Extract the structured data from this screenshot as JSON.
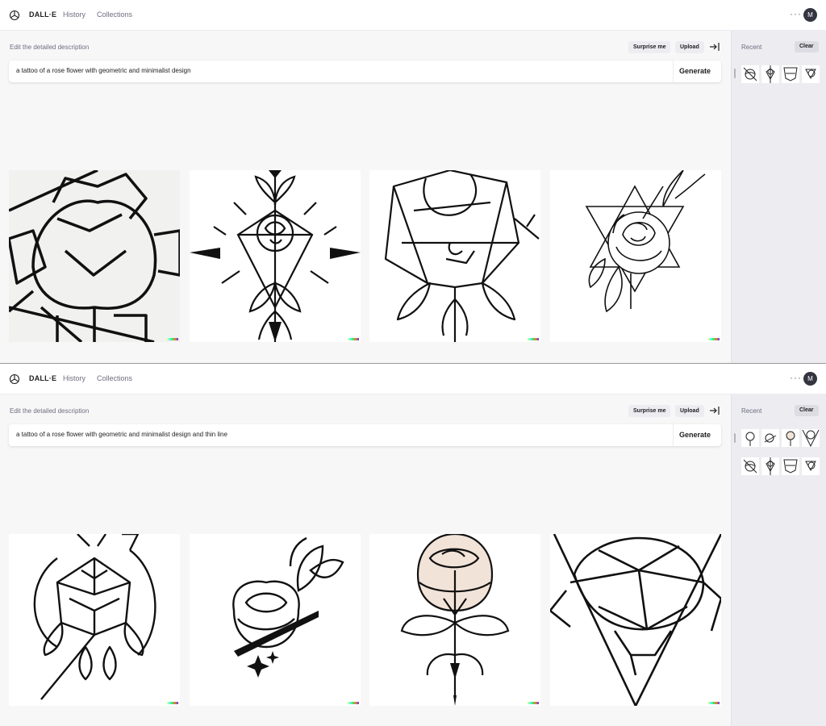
{
  "panels": [
    {
      "brand": "DALL·E",
      "nav": {
        "history": "History",
        "collections": "Collections"
      },
      "more": "···",
      "avatar": "M",
      "description_label": "Edit the detailed description",
      "surprise_label": "Surprise me",
      "upload_label": "Upload",
      "prompt": "a tattoo of a rose flower with geometric and minimalist design",
      "generate_label": "Generate",
      "recent_label": "Recent",
      "clear_label": "Clear"
    },
    {
      "brand": "DALL·E",
      "nav": {
        "history": "History",
        "collections": "Collections"
      },
      "more": "···",
      "avatar": "M",
      "description_label": "Edit the detailed description",
      "surprise_label": "Surprise me",
      "upload_label": "Upload",
      "prompt": "a tattoo of a rose flower with geometric and minimalist design and thin line",
      "generate_label": "Generate",
      "recent_label": "Recent",
      "clear_label": "Clear"
    }
  ],
  "icons": {
    "logo": "openai-logo-icon",
    "collapse": "collapse-sidebar-icon",
    "more": "more-options-icon"
  },
  "colors": {
    "background": "#f7f7f8",
    "text": "#202123",
    "muted": "#6e6e80",
    "pill": "#ececf1",
    "avatar": "#343541"
  }
}
